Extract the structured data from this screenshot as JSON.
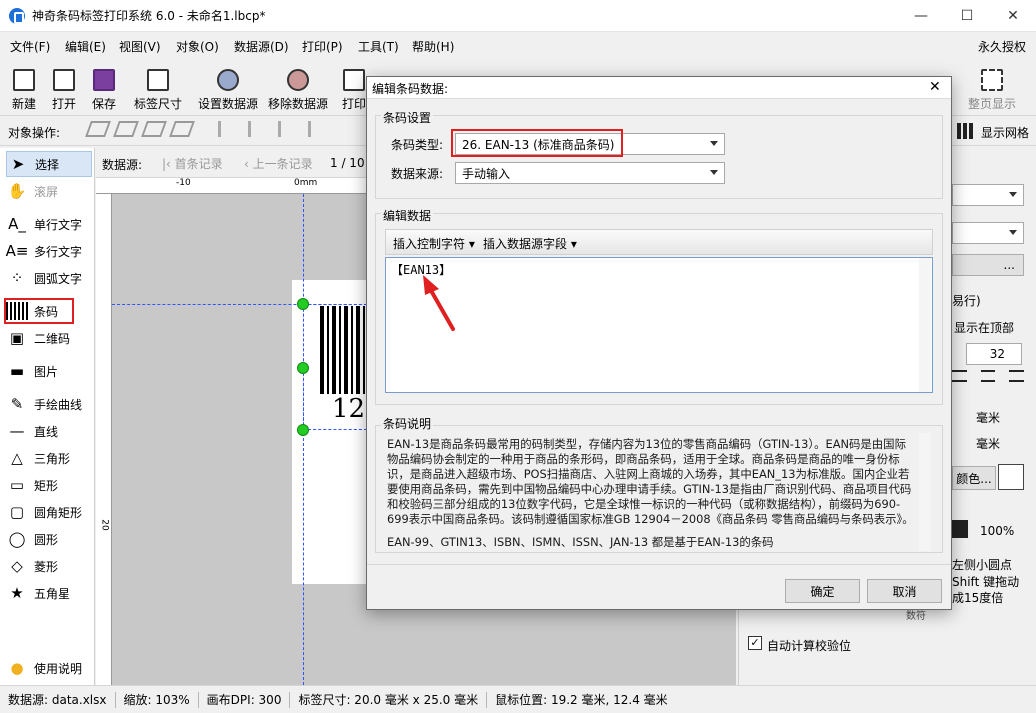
{
  "window": {
    "title": "神奇条码标签打印系统 6.0 - 未命名1.lbcp*",
    "minimize": "—",
    "maximize": "☐",
    "close": "✕"
  },
  "menu": {
    "items": [
      "文件(F)",
      "编辑(E)",
      "视图(V)",
      "对象(O)",
      "数据源(D)",
      "打印(P)",
      "工具(T)",
      "帮助(H)"
    ],
    "license": "永久授权"
  },
  "toolbar": {
    "new": "新建",
    "open": "打开",
    "save": "保存",
    "label_size": "标签尺寸",
    "set_datasource": "设置数据源",
    "remove_datasource": "移除数据源",
    "print": "打印",
    "full_page": "整页显示"
  },
  "objbar": {
    "label": "对象操作:",
    "show_grid": "显示网格"
  },
  "tools": {
    "select": "选择",
    "pan": "滚屏",
    "single_text": "单行文字",
    "multi_text": "多行文字",
    "arc_text": "圆弧文字",
    "barcode": "条码",
    "qrcode": "二维码",
    "image": "图片",
    "freehand": "手绘曲线",
    "line": "直线",
    "triangle": "三角形",
    "rect": "矩形",
    "round_rect": "圆角矩形",
    "circle": "圆形",
    "diamond": "菱形",
    "star": "五角星",
    "help": "使用说明"
  },
  "nav": {
    "label": "数据源:",
    "first": "首条记录",
    "prev": "上一条记录",
    "page": "1 / 10"
  },
  "ruler": {
    "m10": "-10",
    "zero": "0mm",
    "v20": "20"
  },
  "canvas": {
    "barcode_text": "12"
  },
  "right": {
    "value_32": "32",
    "unit1": "毫米",
    "unit2": "毫米",
    "pct": "100%",
    "color_btn": "颜色...",
    "auto_check": "自动计算校验位",
    "text_top": "显示在顶部",
    "text_easy": "易行)",
    "hint1": "左侧小圆点",
    "hint2": "Shift 键拖动",
    "hint3": "成15度倍",
    "frag": "数符",
    "dots": "..."
  },
  "dialog": {
    "title": "编辑条码数据:",
    "close": "✕",
    "group_settings": "条码设置",
    "type_label": "条码类型:",
    "type_value": "26. EAN-13 (标准商品条码)",
    "source_label": "数据来源:",
    "source_value": "手动输入",
    "group_data": "编辑数据",
    "insert_ctrl": "插入控制字符",
    "insert_field": "插入数据源字段",
    "data_value": "【EAN13】",
    "group_desc": "条码说明",
    "desc": "EAN-13是商品条码最常用的码制类型，存储内容为13位的零售商品编码（GTIN-13）。EAN码是由国际物品编码协会制定的一种用于商品的条形码，即商品条码，适用于全球。商品条码是商品的唯一身份标识，是商品进入超级市场、POS扫描商店、入驻网上商城的入场券，其中EAN_13为标准版。国内企业若要使用商品条码，需先到中国物品编码中心办理申请手续。GTIN-13是指由厂商识别代码、商品项目代码和校验码三部分组成的13位数字代码，它是全球惟一标识的一种代码（或称数据结构），前缀码为690-699表示中国商品条码。该码制遵循国家标准GB 12904－2008《商品条码 零售商品编码与条码表示》。",
    "desc2": "EAN-99、GTIN13、ISBN、ISMN、ISSN、JAN-13 都是基于EAN-13的条码",
    "ok": "确定",
    "cancel": "取消"
  },
  "status": {
    "datasource": "数据源: data.xlsx",
    "zoom": "缩放: 103%",
    "dpi": "画布DPI: 300",
    "size": "标签尺寸: 20.0 毫米 x 25.0 毫米",
    "mouse": "鼠标位置: 19.2 毫米, 12.4 毫米"
  },
  "colors": {
    "accent": "#e02020",
    "handle": "#22cc22",
    "guide": "#3355ff"
  }
}
